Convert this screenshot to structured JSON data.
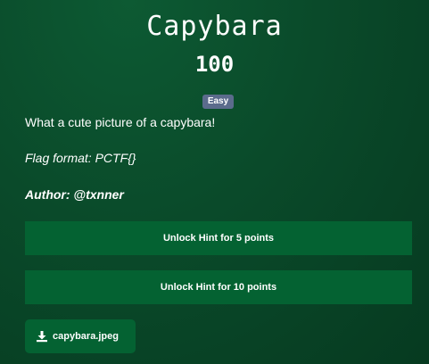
{
  "challenge": {
    "title": "Capybara",
    "points": "100",
    "difficulty": "Easy",
    "description": "What a cute picture of a capybara!",
    "flag_format": "Flag format: PCTF{}",
    "author": "Author: @txnner"
  },
  "hints": [
    {
      "label": "Unlock Hint for 5 points"
    },
    {
      "label": "Unlock Hint for 10 points"
    }
  ],
  "download": {
    "filename": "capybara.jpeg",
    "icon": "download-icon"
  },
  "colors": {
    "background": "#0a4a2a",
    "button": "#046232",
    "badge": "#5b6b8c"
  }
}
